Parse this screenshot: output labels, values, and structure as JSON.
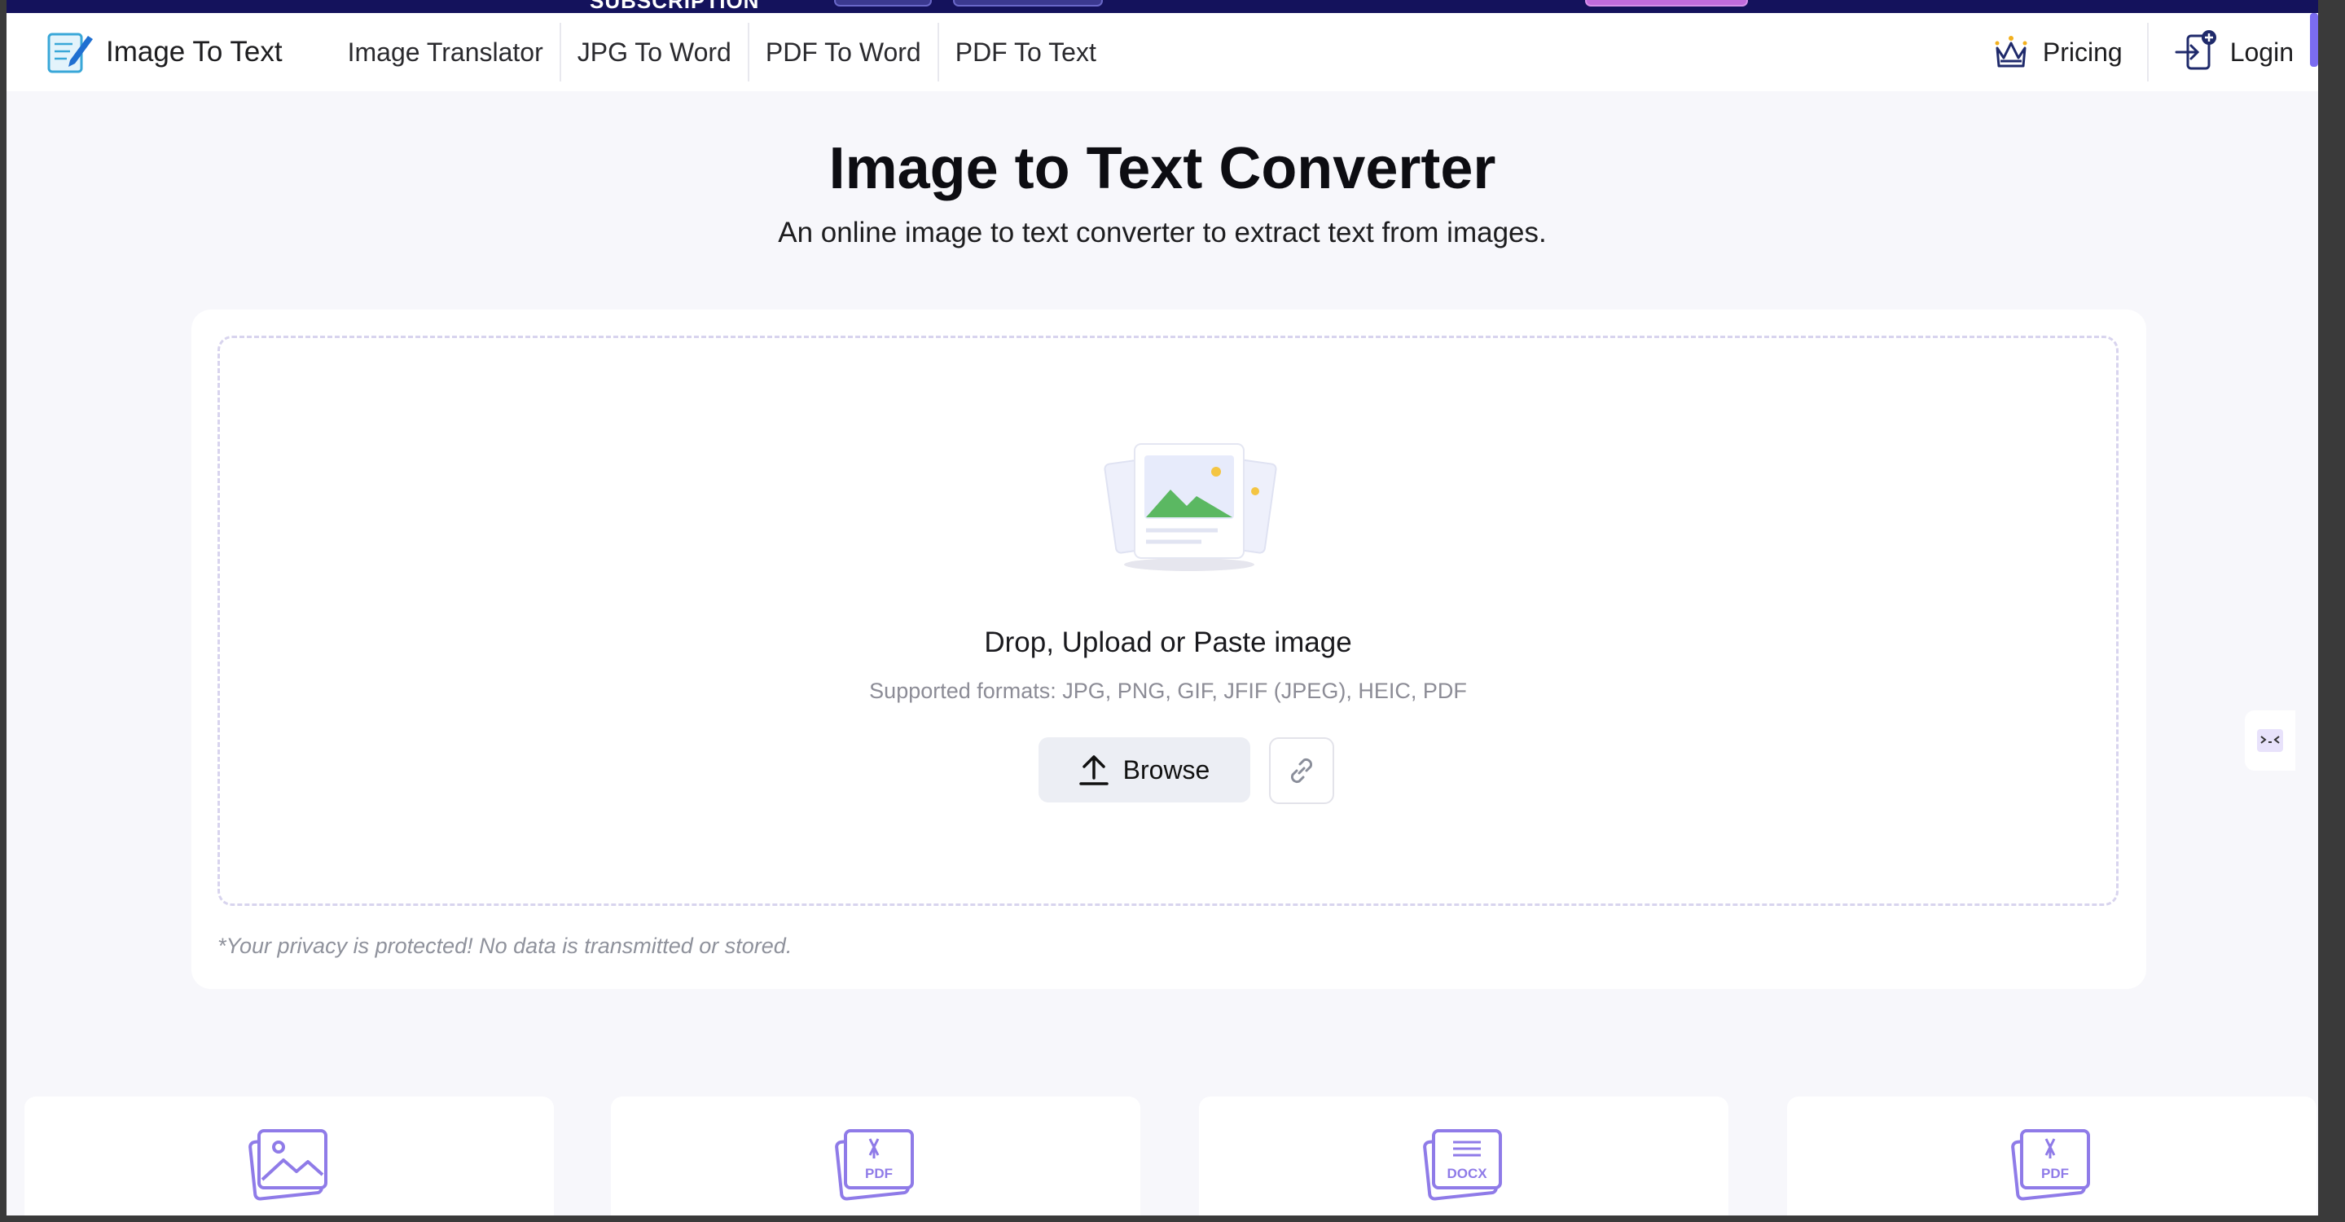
{
  "navbar": {
    "brand": "Image To Text",
    "links": [
      {
        "label": "Image Translator"
      },
      {
        "label": "JPG To Word"
      },
      {
        "label": "PDF To Word"
      },
      {
        "label": "PDF To Text"
      }
    ],
    "pricing": "Pricing",
    "login": "Login"
  },
  "banner": {
    "text": "SUBSCRIPTION"
  },
  "hero": {
    "title": "Image to Text Converter",
    "subtitle": "An online image to text converter to extract text from images."
  },
  "upload": {
    "prompt": "Drop, Upload or Paste image",
    "formats": "Supported formats: JPG, PNG, GIF, JFIF (JPEG), HEIC, PDF",
    "browse_label": "Browse",
    "privacy": "*Your privacy is protected! No data is transmitted or stored."
  },
  "tools": [
    {
      "icon": "image-icon",
      "badge": ""
    },
    {
      "icon": "pdf-file-icon",
      "badge": "PDF"
    },
    {
      "icon": "docx-file-icon",
      "badge": "DOCX"
    },
    {
      "icon": "pdf-file-icon",
      "badge": "PDF"
    }
  ],
  "colors": {
    "accent": "#7b6cf0",
    "banner": "#14125c",
    "page_bg": "#f7f7fb",
    "button_bg": "#eceef4"
  }
}
